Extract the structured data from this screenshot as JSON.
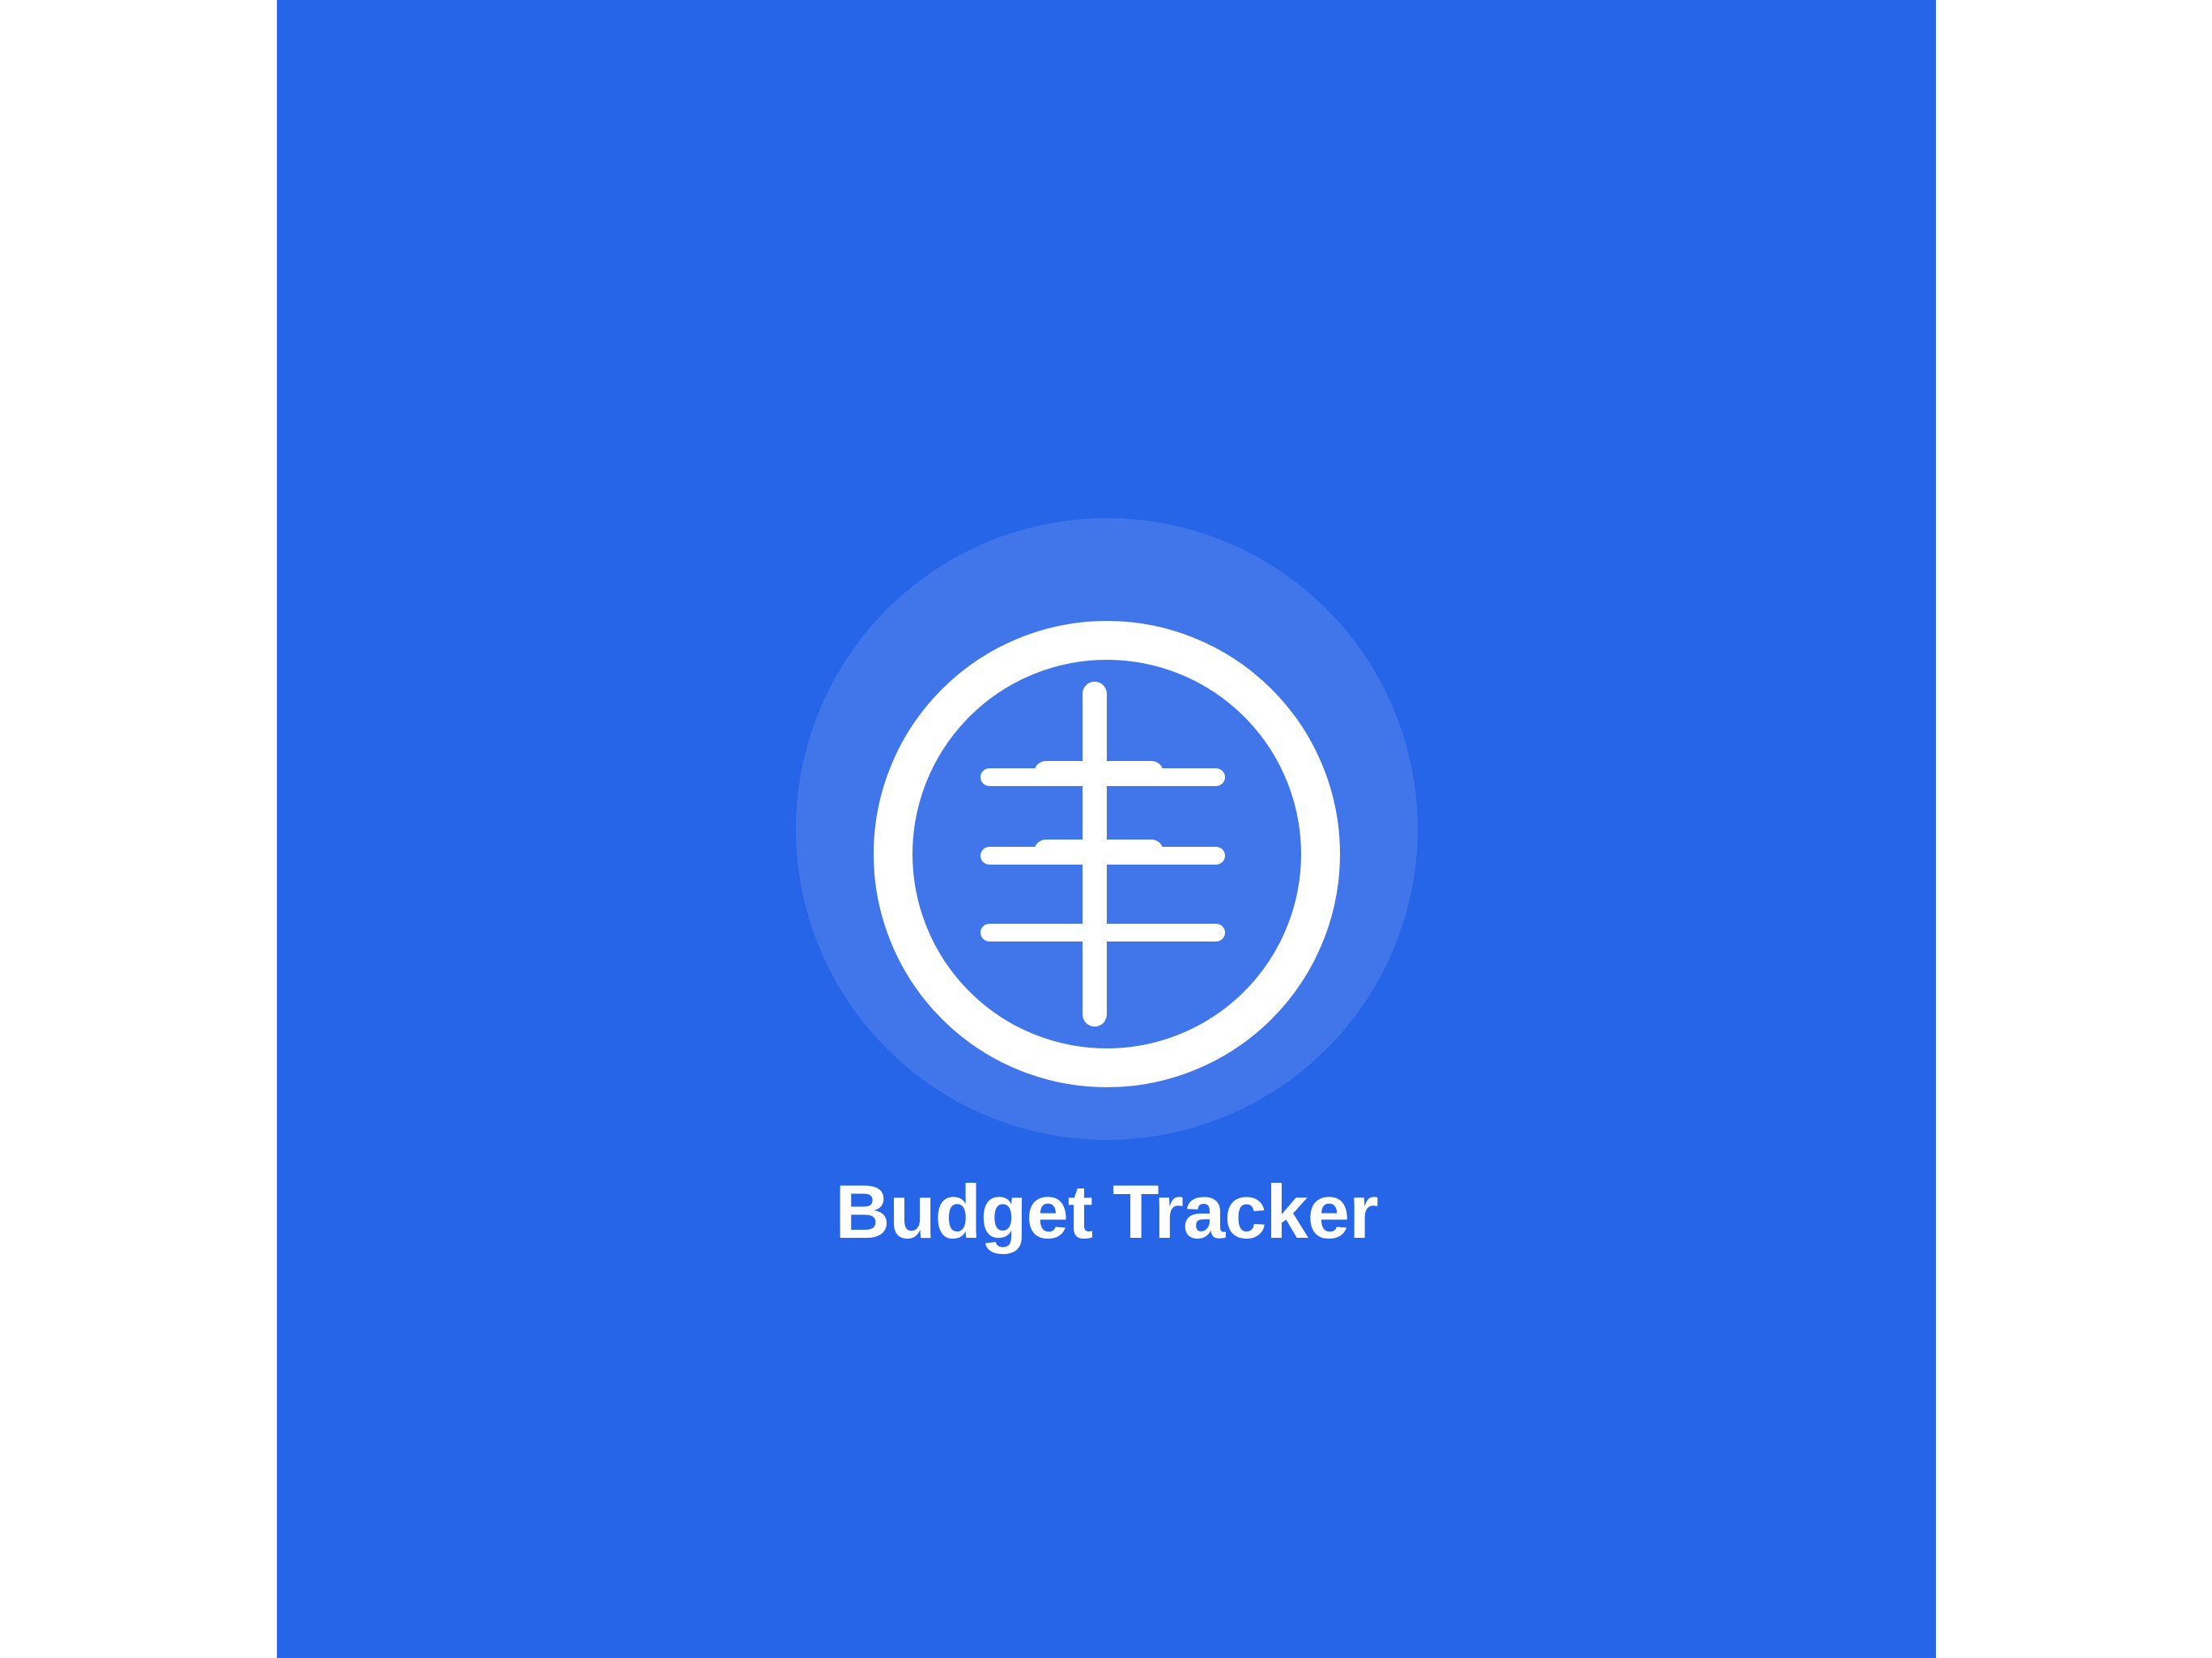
{
  "splash": {
    "app_name": "Budget Tracker",
    "logo_icon": "coin-ledger-icon"
  },
  "colors": {
    "background": "#2664E8",
    "foreground": "#FFFFFF",
    "halo": "rgba(255,255,255,0.12)"
  }
}
